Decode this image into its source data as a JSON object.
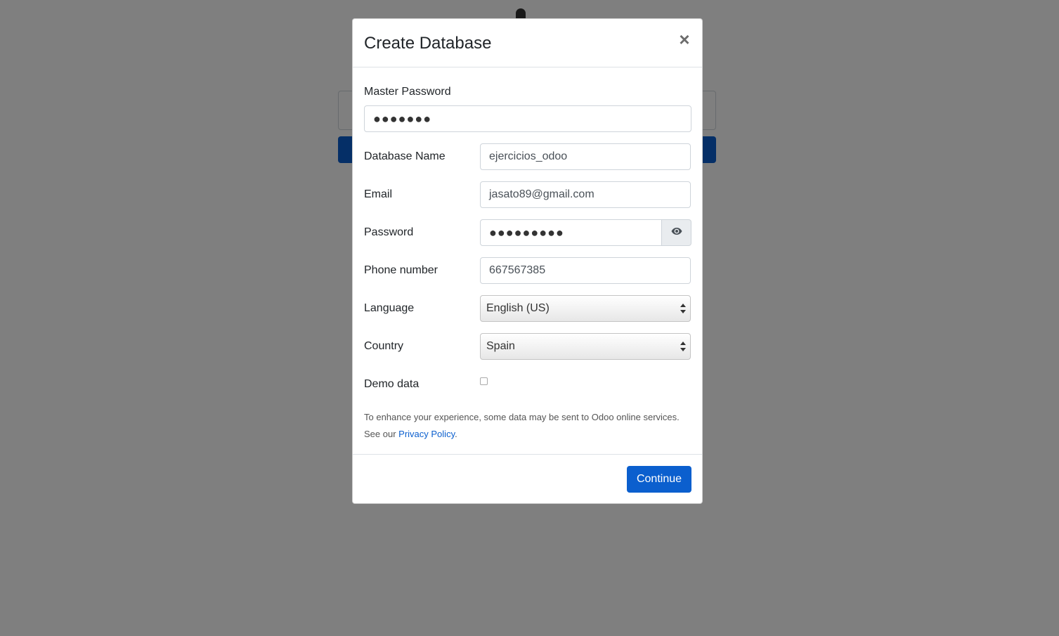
{
  "modal": {
    "title": "Create Database",
    "close_glyph": "×"
  },
  "form": {
    "master_password": {
      "label": "Master Password",
      "value": "●●●●●●●"
    },
    "database_name": {
      "label": "Database Name",
      "value": "ejercicios_odoo"
    },
    "email": {
      "label": "Email",
      "value": "jasato89@gmail.com"
    },
    "password": {
      "label": "Password",
      "value": "●●●●●●●●●",
      "toggle_icon": "eye-icon"
    },
    "phone": {
      "label": "Phone number",
      "value": "667567385"
    },
    "language": {
      "label": "Language",
      "value": "English (US)"
    },
    "country": {
      "label": "Country",
      "value": "Spain"
    },
    "demo_data": {
      "label": "Demo data",
      "checked": false
    }
  },
  "notice": {
    "text": "To enhance your experience, some data may be sent to Odoo online services. See our ",
    "link": "Privacy Policy",
    "suffix": "."
  },
  "footer": {
    "continue_label": "Continue"
  },
  "colors": {
    "primary": "#0b5fce",
    "link": "#0b5fce",
    "backdrop": "rgba(0,0,0,0.5)"
  }
}
